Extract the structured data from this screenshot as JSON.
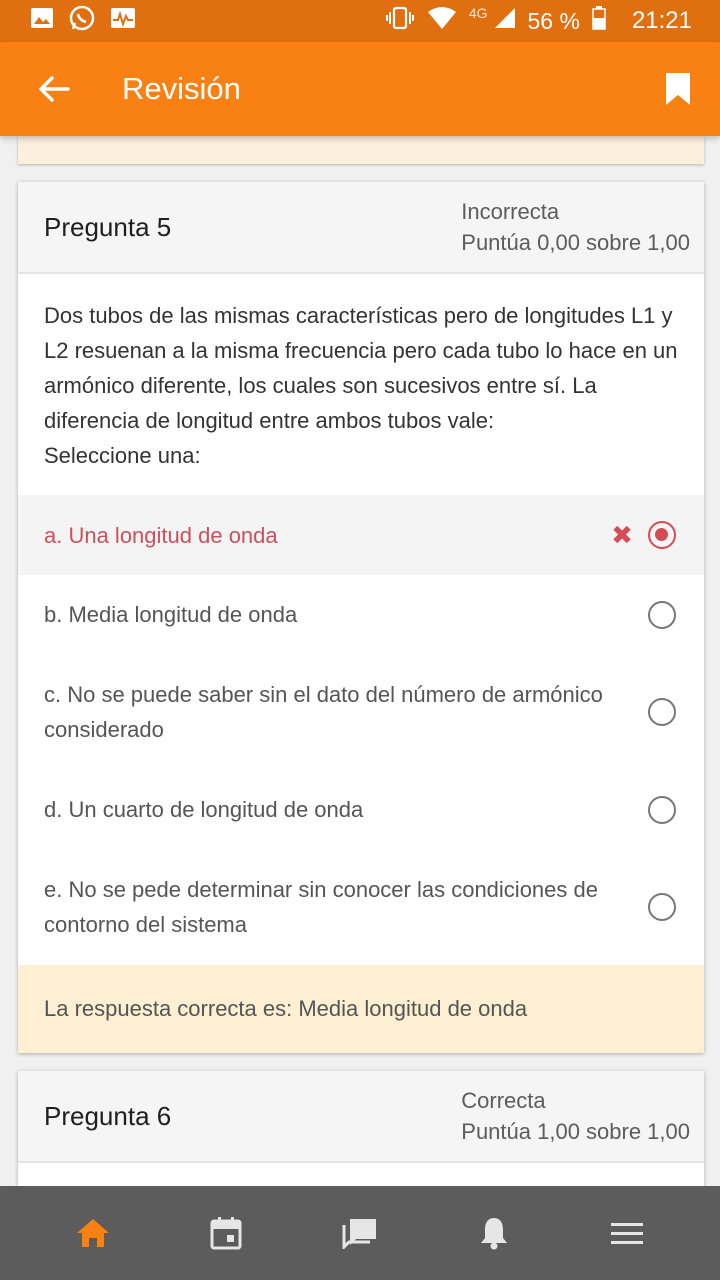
{
  "status_bar": {
    "network": "4G",
    "battery": "56 %",
    "time": "21:21"
  },
  "app_bar": {
    "title": "Revisión"
  },
  "questions": [
    {
      "title": "Pregunta 5",
      "status": "Incorrecta",
      "score": "Puntúa 0,00 sobre 1,00",
      "text": "Dos tubos de las mismas características pero de longitudes L1 y L2 resuenan a la misma frecuencia pero cada tubo lo hace en un armónico diferente, los cuales son sucesivos entre sí. La diferencia de longitud entre ambos tubos vale:",
      "prompt": "Seleccione una:",
      "options": [
        {
          "label": "a. Una longitud de onda",
          "selected": true,
          "incorrect": true
        },
        {
          "label": "b. Media longitud de onda",
          "selected": false
        },
        {
          "label": "c. No se puede saber sin el dato del número de armónico considerado",
          "selected": false
        },
        {
          "label": "d. Un cuarto de longitud de onda",
          "selected": false
        },
        {
          "label": "e. No se pede determinar sin conocer las condiciones de contorno del sistema",
          "selected": false
        }
      ],
      "feedback": "La respuesta correcta es: Media longitud de onda"
    },
    {
      "title": "Pregunta 6",
      "status": "Correcta",
      "score": "Puntúa 1,00 sobre 1,00"
    }
  ],
  "bottom_nav": [
    "home-icon",
    "calendar-icon",
    "messages-icon",
    "notifications-icon",
    "menu-icon"
  ],
  "colors": {
    "accent": "#f98012",
    "status_bar": "#e06f10",
    "incorrect": "#d64c56",
    "feedback_bg": "#fcefd2",
    "bottom_nav": "#5c5c5c"
  }
}
